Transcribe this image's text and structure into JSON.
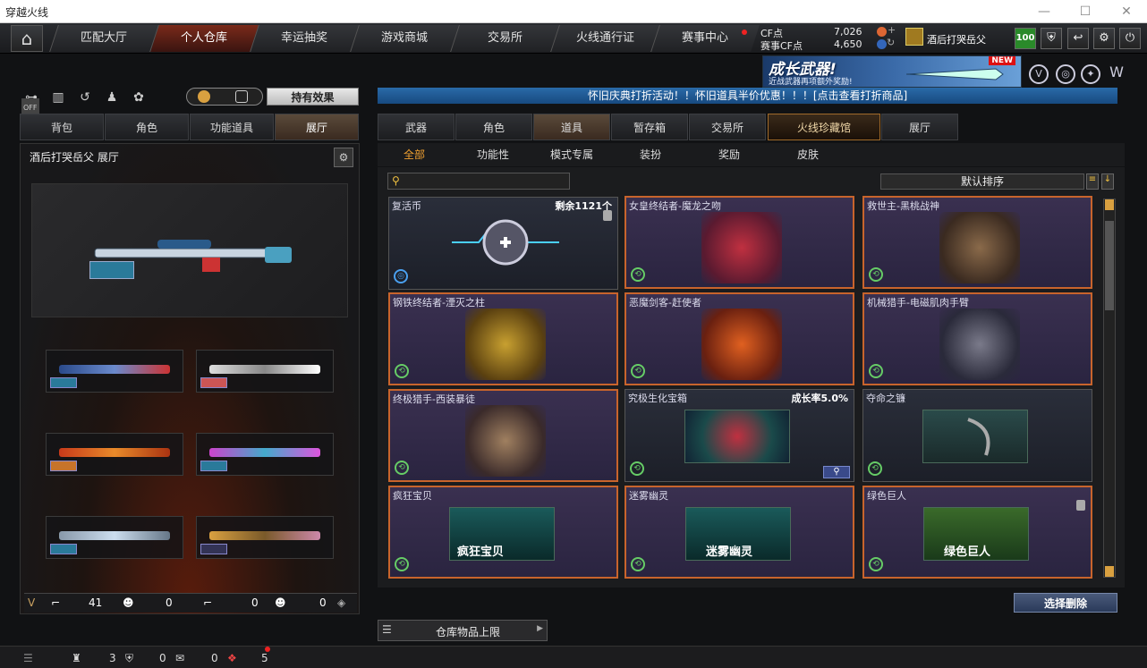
{
  "window": {
    "title": "穿越火线",
    "controls": [
      "—",
      "☐",
      "✕"
    ]
  },
  "nav": {
    "home_icon": "home-icon",
    "tabs": [
      "匹配大厅",
      "个人仓库",
      "幸运抽奖",
      "游戏商城",
      "交易所",
      "火线通行证",
      "赛事中心"
    ],
    "active_tab": "个人仓库"
  },
  "currency": {
    "cf_label": "CF点",
    "cf_value": "7,026",
    "event_label": "赛事CF点",
    "event_value": "4,650"
  },
  "user": {
    "name": "酒后打哭岳父",
    "level": "100"
  },
  "banner": {
    "title": "成长武器!",
    "subtitle": "近战武器再项额外奖励!",
    "badge": "NEW"
  },
  "left": {
    "off_label": "OFF",
    "held_effect": "持有效果",
    "tabs": [
      "背包",
      "角色",
      "功能道具",
      "展厅"
    ],
    "active_tab": "展厅",
    "panel_title": "酒后打哭岳父  展厅",
    "stats": [
      "41",
      "0",
      "0",
      "0"
    ]
  },
  "right": {
    "notice": "怀旧庆典打折活动！！怀旧道具半价优惠！！！[点击查看打折商品]",
    "tabs": [
      "武器",
      "角色",
      "道具",
      "暂存箱",
      "交易所",
      "火线珍藏馆",
      "展厅"
    ],
    "active_tab": "道具",
    "subtabs": [
      "全部",
      "功能性",
      "模式专属",
      "装扮",
      "奖励",
      "皮肤"
    ],
    "active_subtab": "全部",
    "search_placeholder": "",
    "sort_label": "默认排序",
    "items": [
      {
        "name": "复活币",
        "note": "剩余1121个"
      },
      {
        "name": "女皇终结者-魔龙之吻",
        "note": ""
      },
      {
        "name": "救世主-黑桃战神",
        "note": ""
      },
      {
        "name": "钢铁终结者-湮灭之柱",
        "note": ""
      },
      {
        "name": "恶魔剑客-赶使者",
        "note": ""
      },
      {
        "name": "机械猎手-电磁肌肉手臂",
        "note": ""
      },
      {
        "name": "终极猎手-西装暴徒",
        "note": ""
      },
      {
        "name": "究极生化宝箱",
        "note": "成长率5.0%"
      },
      {
        "name": "夺命之镰",
        "note": ""
      },
      {
        "name": "疯狂宝贝",
        "note": "",
        "art_label": "疯狂宝贝"
      },
      {
        "name": "迷雾幽灵",
        "note": "",
        "art_label": "迷雾幽灵"
      },
      {
        "name": "绿色巨人",
        "note": "",
        "art_label": "绿色巨人"
      }
    ],
    "delete_button": "选择删除",
    "capacity_button": "仓库物品上限"
  },
  "bottom": {
    "counts": [
      "3",
      "0",
      "0",
      "5"
    ]
  }
}
